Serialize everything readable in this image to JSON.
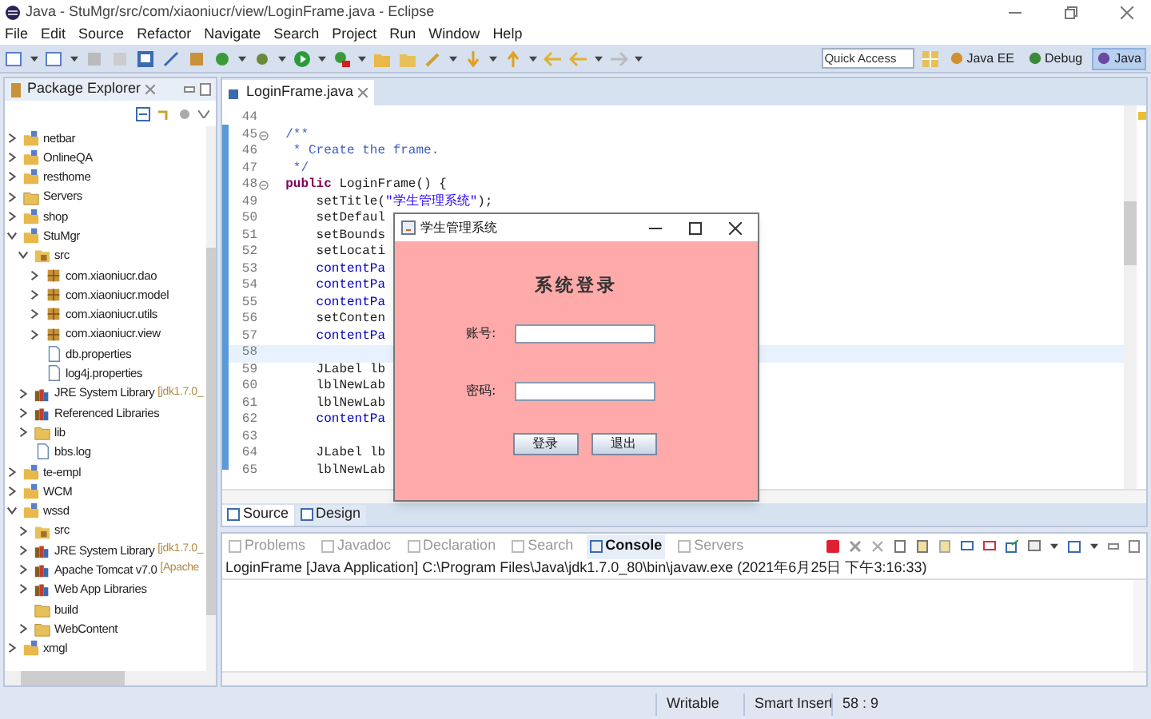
{
  "window": {
    "title": "Java - StuMgr/src/com/xiaoniucr/view/LoginFrame.java - Eclipse"
  },
  "menu": [
    {
      "label": "File"
    },
    {
      "label": "Edit"
    },
    {
      "label": "Source"
    },
    {
      "label": "Refactor"
    },
    {
      "label": "Navigate"
    },
    {
      "label": "Search"
    },
    {
      "label": "Project"
    },
    {
      "label": "Run"
    },
    {
      "label": "Window"
    },
    {
      "label": "Help"
    }
  ],
  "toolbar": {
    "quick_access": "Quick Access",
    "perspectives": [
      {
        "label": "Java EE",
        "selected": false
      },
      {
        "label": "Debug",
        "selected": false
      },
      {
        "label": "Java",
        "selected": true
      }
    ]
  },
  "package_explorer": {
    "title": "Package Explorer",
    "tree": [
      {
        "label": "netbar",
        "kind": "project",
        "expanded": false
      },
      {
        "label": "OnlineQA",
        "kind": "project",
        "expanded": false
      },
      {
        "label": "resthome",
        "kind": "project",
        "expanded": false
      },
      {
        "label": "Servers",
        "kind": "folder",
        "expanded": false
      },
      {
        "label": "shop",
        "kind": "project",
        "expanded": false
      },
      {
        "label": "StuMgr",
        "kind": "project",
        "expanded": true,
        "children": [
          {
            "label": "src",
            "kind": "source",
            "expanded": true,
            "children": [
              {
                "label": "com.xiaoniucr.dao",
                "kind": "package",
                "expanded": false
              },
              {
                "label": "com.xiaoniucr.model",
                "kind": "package",
                "expanded": false
              },
              {
                "label": "com.xiaoniucr.utils",
                "kind": "package",
                "expanded": false
              },
              {
                "label": "com.xiaoniucr.view",
                "kind": "package",
                "expanded": false
              },
              {
                "label": "db.properties",
                "kind": "file"
              },
              {
                "label": "log4j.properties",
                "kind": "file"
              }
            ]
          },
          {
            "label": "JRE System Library",
            "detail": "[jdk1.7.0_",
            "kind": "library",
            "expanded": false
          },
          {
            "label": "Referenced Libraries",
            "kind": "library",
            "expanded": false
          },
          {
            "label": "lib",
            "kind": "folder",
            "expanded": false
          },
          {
            "label": "bbs.log",
            "kind": "file"
          }
        ]
      },
      {
        "label": "te-empl",
        "kind": "project",
        "expanded": false
      },
      {
        "label": "WCM",
        "kind": "project",
        "expanded": false
      },
      {
        "label": "wssd",
        "kind": "project",
        "expanded": true,
        "children": [
          {
            "label": "src",
            "kind": "source",
            "expanded": false
          },
          {
            "label": "JRE System Library",
            "detail": "[jdk1.7.0_",
            "kind": "library",
            "expanded": false
          },
          {
            "label": "Apache Tomcat v7.0",
            "detail": "[Apache",
            "kind": "library",
            "expanded": false
          },
          {
            "label": "Web App Libraries",
            "kind": "library",
            "expanded": false
          },
          {
            "label": "build",
            "kind": "folder"
          },
          {
            "label": "WebContent",
            "kind": "folder",
            "expanded": false
          }
        ]
      },
      {
        "label": "xmgl",
        "kind": "project",
        "expanded": false
      }
    ]
  },
  "editor": {
    "tabs": [
      {
        "label": "LoginFrame.java",
        "selected": true
      }
    ],
    "lines": [
      {
        "number": "44"
      },
      {
        "number": "45",
        "fold": true,
        "segments": [
          {
            "text": "  /**",
            "kind": "comment"
          }
        ]
      },
      {
        "number": "46",
        "segments": [
          {
            "text": "   * Create the frame.",
            "kind": "comment"
          }
        ]
      },
      {
        "number": "47",
        "segments": [
          {
            "text": "   */",
            "kind": "comment"
          }
        ]
      },
      {
        "number": "48",
        "fold": true,
        "segments": [
          {
            "text": "  public",
            "kind": "keyword"
          },
          {
            "text": " LoginFrame() {",
            "kind": "plain"
          }
        ]
      },
      {
        "number": "49",
        "segments": [
          {
            "text": "      setTitle(",
            "kind": "plain"
          },
          {
            "text": "\"学生管理系统\"",
            "kind": "string"
          },
          {
            "text": ");",
            "kind": "plain"
          }
        ]
      },
      {
        "number": "50",
        "segments": [
          {
            "text": "      setDefaul",
            "kind": "plain"
          }
        ]
      },
      {
        "number": "51",
        "segments": [
          {
            "text": "      setBounds",
            "kind": "plain"
          }
        ]
      },
      {
        "number": "52",
        "segments": [
          {
            "text": "      setLocati",
            "kind": "plain"
          }
        ]
      },
      {
        "number": "53",
        "segments": [
          {
            "text": "      contentPa",
            "kind": "field"
          }
        ]
      },
      {
        "number": "54",
        "segments": [
          {
            "text": "      contentPa",
            "kind": "field"
          }
        ]
      },
      {
        "number": "55",
        "segments": [
          {
            "text": "      contentPa",
            "kind": "field"
          }
        ]
      },
      {
        "number": "56",
        "segments": [
          {
            "text": "      setConten",
            "kind": "plain"
          }
        ]
      },
      {
        "number": "57",
        "segments": [
          {
            "text": "      contentPa",
            "kind": "field"
          }
        ]
      },
      {
        "number": "58",
        "current": true
      },
      {
        "number": "59",
        "segments": [
          {
            "text": "      JLabel lb",
            "kind": "plain"
          }
        ]
      },
      {
        "number": "60",
        "segments": [
          {
            "text": "      lblNewLab",
            "kind": "plain"
          }
        ]
      },
      {
        "number": "61",
        "segments": [
          {
            "text": "      lblNewLab",
            "kind": "plain"
          }
        ]
      },
      {
        "number": "62",
        "segments": [
          {
            "text": "      contentPa",
            "kind": "field"
          }
        ]
      },
      {
        "number": "63"
      },
      {
        "number": "64",
        "segments": [
          {
            "text": "      JLabel lb",
            "kind": "plain"
          }
        ]
      },
      {
        "number": "65",
        "segments": [
          {
            "text": "      lblNewLab",
            "kind": "plain"
          }
        ]
      }
    ],
    "bottom_tabs": [
      {
        "label": "Source",
        "selected": true
      },
      {
        "label": "Design",
        "selected": false
      }
    ]
  },
  "dialog": {
    "title": "学生管理系统",
    "heading": "系统登录",
    "fields": [
      {
        "label": "账号:"
      },
      {
        "label": "密码:"
      }
    ],
    "buttons": [
      "登录",
      "退出"
    ]
  },
  "console": {
    "tabs": [
      {
        "label": "Problems",
        "selected": false
      },
      {
        "label": "Javadoc",
        "selected": false
      },
      {
        "label": "Declaration",
        "selected": false
      },
      {
        "label": "Search",
        "selected": false
      },
      {
        "label": "Console",
        "selected": true
      },
      {
        "label": "Servers",
        "selected": false
      }
    ],
    "header": "LoginFrame [Java Application] C:\\Program Files\\Java\\jdk1.7.0_80\\bin\\javaw.exe (2021年6月25日 下午3:16:33)"
  },
  "status_bar": [
    "Writable",
    "Smart Insert",
    "58 : 9"
  ]
}
